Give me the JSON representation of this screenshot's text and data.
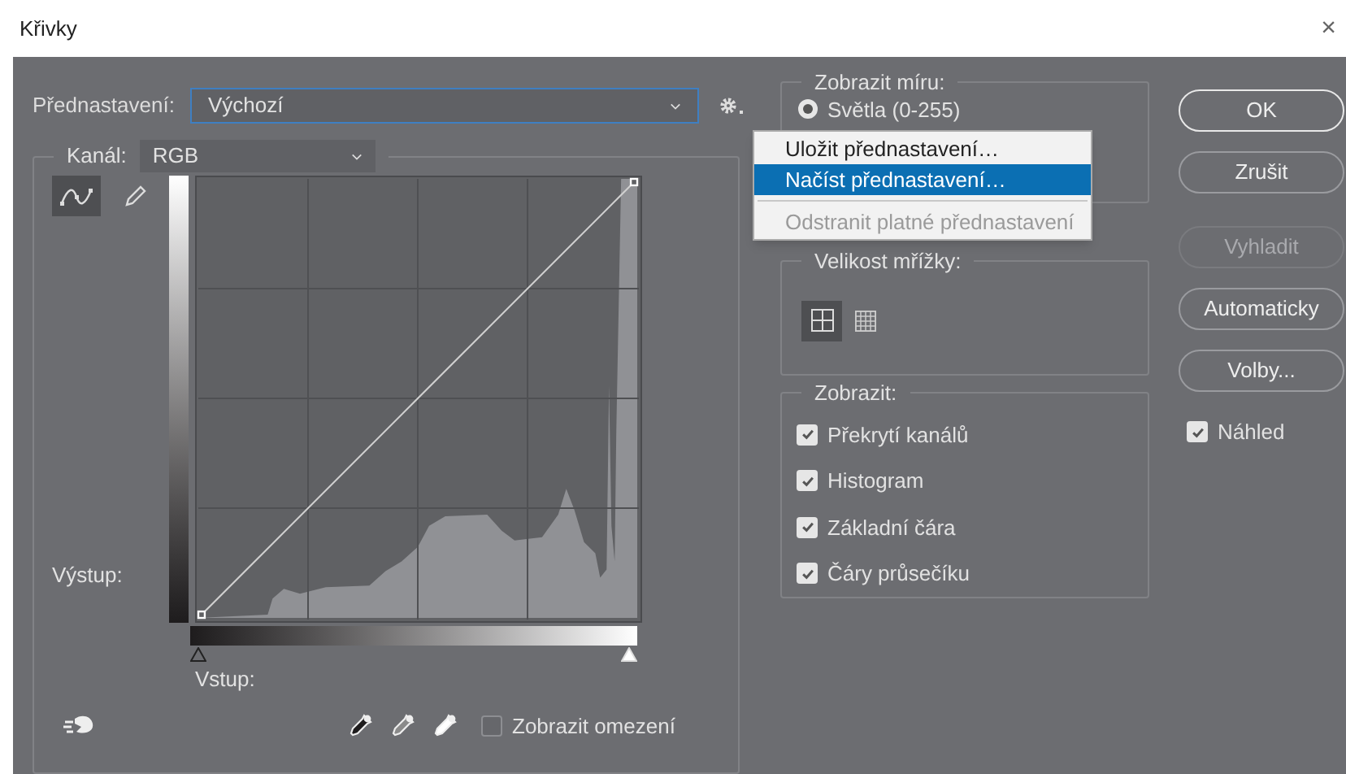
{
  "window": {
    "title": "Křivky",
    "close": "×"
  },
  "preset": {
    "label": "Přednastavení:",
    "value": "Výchozí"
  },
  "preset_menu": [
    {
      "label": "Uložit přednastavení…",
      "selected": false,
      "disabled": false
    },
    {
      "label": "Načíst přednastavení…",
      "selected": true,
      "disabled": false
    },
    {
      "label": "Odstranit platné přednastavení",
      "selected": false,
      "disabled": true
    }
  ],
  "channel": {
    "label": "Kanál:",
    "value": "RGB"
  },
  "curve_tools": [
    {
      "kind": "curve",
      "selected": true
    },
    {
      "kind": "pencil",
      "selected": false
    }
  ],
  "output_label": "Výstup:",
  "input_sliders": [
    {
      "kind": "shadow",
      "level": 0
    },
    {
      "kind": "highlight",
      "level": 1
    }
  ],
  "input_label": "Vstup:",
  "clipping": {
    "label": "Zobrazit omezení",
    "checked": false
  },
  "show_amount": {
    "title": "Zobrazit míru:",
    "options": [
      {
        "label": "Světla (0-255)",
        "selected": true
      }
    ]
  },
  "grid_size": {
    "title": "Velikost mřížky:",
    "options": [
      {
        "kind": "simple",
        "selected": true
      },
      {
        "kind": "detailed",
        "selected": false
      }
    ]
  },
  "show": {
    "title": "Zobrazit:",
    "options": [
      {
        "label": "Překrytí kanálů",
        "checked": true
      },
      {
        "label": "Histogram",
        "checked": true
      },
      {
        "label": "Základní čára",
        "checked": true
      },
      {
        "label": "Čáry průsečíku",
        "checked": true
      }
    ]
  },
  "buttons": [
    {
      "label": "OK",
      "default": true,
      "disabled": false
    },
    {
      "label": "Zrušit",
      "default": false,
      "disabled": false
    },
    {
      "label": "Vyhladit",
      "default": false,
      "disabled": true
    },
    {
      "label": "Automaticky",
      "default": false,
      "disabled": false
    },
    {
      "label": "Volby...",
      "default": false,
      "disabled": false
    }
  ],
  "preview": {
    "label": "Náhled",
    "checked": true
  }
}
